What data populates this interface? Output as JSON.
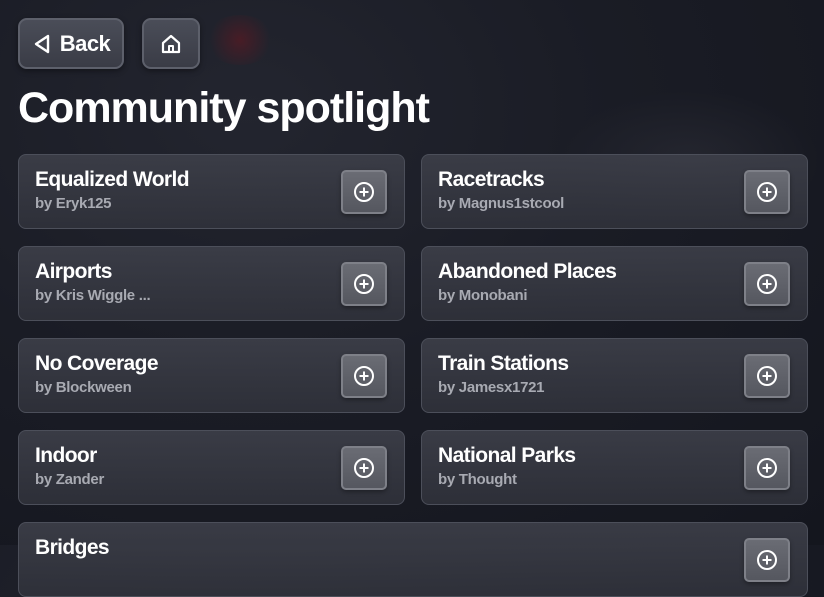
{
  "header": {
    "back_label": "Back",
    "back_icon": "triangle-left-icon",
    "home_icon": "home-icon",
    "title": "Community spotlight"
  },
  "maps": [
    {
      "title": "Equalized World",
      "author": "by Eryk125"
    },
    {
      "title": "Racetracks",
      "author": "by Magnus1stcool"
    },
    {
      "title": "Airports",
      "author": "by Kris Wiggle ..."
    },
    {
      "title": "Abandoned Places",
      "author": "by Monobani"
    },
    {
      "title": "No Coverage",
      "author": "by Blockween"
    },
    {
      "title": "Train Stations",
      "author": "by Jamesx1721"
    },
    {
      "title": "Indoor",
      "author": "by Zander"
    },
    {
      "title": "National Parks",
      "author": "by Thought"
    },
    {
      "title": "Bridges",
      "author": ""
    }
  ],
  "add_icon": "plus-circle-icon"
}
